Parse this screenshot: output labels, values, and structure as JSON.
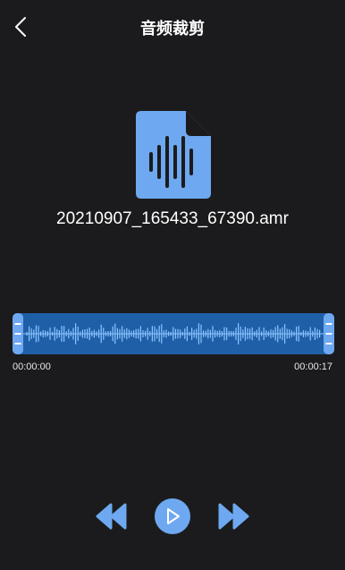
{
  "header": {
    "title": "音频裁剪",
    "back_icon": "chevron-left-icon"
  },
  "file": {
    "icon": "audio-file-icon",
    "name": "20210907_165433_67390.amr"
  },
  "waveform": {
    "selection_start_fraction": 0.0,
    "selection_end_fraction": 1.0
  },
  "timeline": {
    "start": "00:00:00",
    "end": "00:00:17"
  },
  "controls": {
    "rewind_icon": "rewind-icon",
    "play_icon": "play-icon",
    "forward_icon": "fast-forward-icon"
  },
  "colors": {
    "background": "#1b1b1d",
    "accent": "#6ea8f0",
    "waveform_fill": "#1f5fa8",
    "waveform_bars": "#8cc4ff"
  }
}
